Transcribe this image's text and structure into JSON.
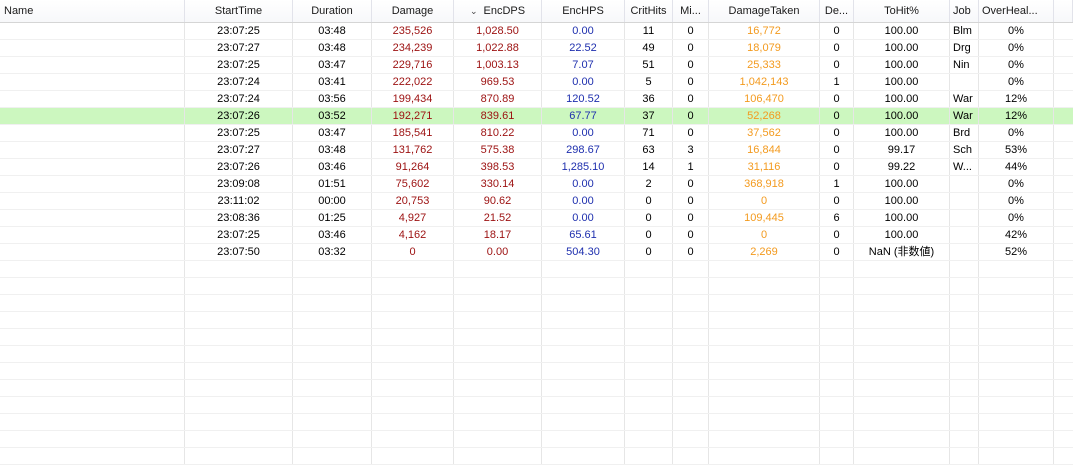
{
  "colors": {
    "damage": "#9c1010",
    "healing": "#1e2fae",
    "taken": "#f39a1e",
    "default": "#000000",
    "selected_row": "#ccf7bf"
  },
  "columns": [
    {
      "key": "name",
      "label": "Name"
    },
    {
      "key": "start",
      "label": "StartTime"
    },
    {
      "key": "duration",
      "label": "Duration"
    },
    {
      "key": "damage",
      "label": "Damage"
    },
    {
      "key": "encdps",
      "label": "EncDPS",
      "sort_icon": "chevron-down-icon",
      "sort_glyph": "⌄"
    },
    {
      "key": "enchps",
      "label": "EncHPS"
    },
    {
      "key": "crithits",
      "label": "CritHits"
    },
    {
      "key": "misses",
      "label": "Mi..."
    },
    {
      "key": "taken",
      "label": "DamageTaken"
    },
    {
      "key": "deaths",
      "label": "De..."
    },
    {
      "key": "tohit",
      "label": "ToHit%"
    },
    {
      "key": "job",
      "label": "Job"
    },
    {
      "key": "overheal",
      "label": "OverHeal..."
    }
  ],
  "selected_row_index": 5,
  "rows": [
    {
      "name": "",
      "start": "23:07:25",
      "duration": "03:48",
      "damage": "235,526",
      "encdps": "1,028.50",
      "enchps": "0.00",
      "crithits": "11",
      "misses": "0",
      "taken": "16,772",
      "deaths": "0",
      "tohit": "100.00",
      "job": "Blm",
      "overheal": "0%"
    },
    {
      "name": "",
      "start": "23:07:27",
      "duration": "03:48",
      "damage": "234,239",
      "encdps": "1,022.88",
      "enchps": "22.52",
      "crithits": "49",
      "misses": "0",
      "taken": "18,079",
      "deaths": "0",
      "tohit": "100.00",
      "job": "Drg",
      "overheal": "0%"
    },
    {
      "name": "",
      "start": "23:07:25",
      "duration": "03:47",
      "damage": "229,716",
      "encdps": "1,003.13",
      "enchps": "7.07",
      "crithits": "51",
      "misses": "0",
      "taken": "25,333",
      "deaths": "0",
      "tohit": "100.00",
      "job": "Nin",
      "overheal": "0%"
    },
    {
      "name": "",
      "start": "23:07:24",
      "duration": "03:41",
      "damage": "222,022",
      "encdps": "969.53",
      "enchps": "0.00",
      "crithits": "5",
      "misses": "0",
      "taken": "1,042,143",
      "deaths": "1",
      "tohit": "100.00",
      "job": "",
      "overheal": "0%"
    },
    {
      "name": "",
      "start": "23:07:24",
      "duration": "03:56",
      "damage": "199,434",
      "encdps": "870.89",
      "enchps": "120.52",
      "crithits": "36",
      "misses": "0",
      "taken": "106,470",
      "deaths": "0",
      "tohit": "100.00",
      "job": "War",
      "overheal": "12%"
    },
    {
      "name": "",
      "start": "23:07:26",
      "duration": "03:52",
      "damage": "192,271",
      "encdps": "839.61",
      "enchps": "67.77",
      "crithits": "37",
      "misses": "0",
      "taken": "52,268",
      "deaths": "0",
      "tohit": "100.00",
      "job": "War",
      "overheal": "12%"
    },
    {
      "name": "",
      "start": "23:07:25",
      "duration": "03:47",
      "damage": "185,541",
      "encdps": "810.22",
      "enchps": "0.00",
      "crithits": "71",
      "misses": "0",
      "taken": "37,562",
      "deaths": "0",
      "tohit": "100.00",
      "job": "Brd",
      "overheal": "0%"
    },
    {
      "name": "",
      "start": "23:07:27",
      "duration": "03:48",
      "damage": "131,762",
      "encdps": "575.38",
      "enchps": "298.67",
      "crithits": "63",
      "misses": "3",
      "taken": "16,844",
      "deaths": "0",
      "tohit": "99.17",
      "job": "Sch",
      "overheal": "53%"
    },
    {
      "name": "",
      "start": "23:07:26",
      "duration": "03:46",
      "damage": "91,264",
      "encdps": "398.53",
      "enchps": "1,285.10",
      "crithits": "14",
      "misses": "1",
      "taken": "31,116",
      "deaths": "0",
      "tohit": "99.22",
      "job": "W...",
      "overheal": "44%"
    },
    {
      "name": "",
      "start": "23:09:08",
      "duration": "01:51",
      "damage": "75,602",
      "encdps": "330.14",
      "enchps": "0.00",
      "crithits": "2",
      "misses": "0",
      "taken": "368,918",
      "deaths": "1",
      "tohit": "100.00",
      "job": "",
      "overheal": "0%"
    },
    {
      "name": "",
      "start": "23:11:02",
      "duration": "00:00",
      "damage": "20,753",
      "encdps": "90.62",
      "enchps": "0.00",
      "crithits": "0",
      "misses": "0",
      "taken": "0",
      "deaths": "0",
      "tohit": "100.00",
      "job": "",
      "overheal": "0%"
    },
    {
      "name": "",
      "start": "23:08:36",
      "duration": "01:25",
      "damage": "4,927",
      "encdps": "21.52",
      "enchps": "0.00",
      "crithits": "0",
      "misses": "0",
      "taken": "109,445",
      "deaths": "6",
      "tohit": "100.00",
      "job": "",
      "overheal": "0%"
    },
    {
      "name": "",
      "start": "23:07:25",
      "duration": "03:46",
      "damage": "4,162",
      "encdps": "18.17",
      "enchps": "65.61",
      "crithits": "0",
      "misses": "0",
      "taken": "0",
      "deaths": "0",
      "tohit": "100.00",
      "job": "",
      "overheal": "42%"
    },
    {
      "name": "",
      "start": "23:07:50",
      "duration": "03:32",
      "damage": "0",
      "encdps": "0.00",
      "enchps": "504.30",
      "crithits": "0",
      "misses": "0",
      "taken": "2,269",
      "deaths": "0",
      "tohit": "NaN (非数値)",
      "job": "",
      "overheal": "52%"
    }
  ]
}
